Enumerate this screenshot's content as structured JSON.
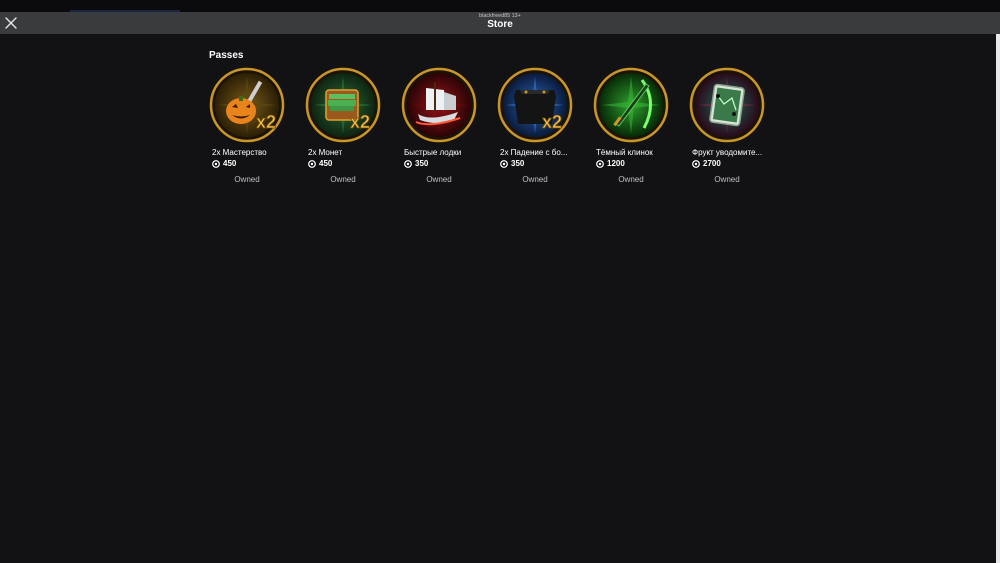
{
  "window": {
    "subtitle": "blackfreed85 13+",
    "title": "Store"
  },
  "section": {
    "title": "Passes"
  },
  "passes": [
    {
      "name": "2x Мастерство",
      "price": "450",
      "status": "Owned",
      "icon": "pumpkin-mastery-icon",
      "accent": "#e07a1a"
    },
    {
      "name": "2x Монет",
      "price": "450",
      "status": "Owned",
      "icon": "money-chest-icon",
      "accent": "#2f8a3a"
    },
    {
      "name": "Быстрые лодки",
      "price": "350",
      "status": "Owned",
      "icon": "ship-icon",
      "accent": "#b0161a"
    },
    {
      "name": "2x Падение с бо...",
      "price": "350",
      "status": "Owned",
      "icon": "cape-drop-icon",
      "accent": "#1e5cb0"
    },
    {
      "name": "Тёмный клинок",
      "price": "1200",
      "status": "Owned",
      "icon": "dark-blade-icon",
      "accent": "#1f8a1f"
    },
    {
      "name": "Фрукт уводомите...",
      "price": "2700",
      "status": "Owned",
      "icon": "fruit-notifier-icon",
      "accent": "#1d6a5a"
    }
  ],
  "colors": {
    "background": "#121214",
    "titlebar": "#3a3b3d",
    "ring": "#c9962a"
  }
}
